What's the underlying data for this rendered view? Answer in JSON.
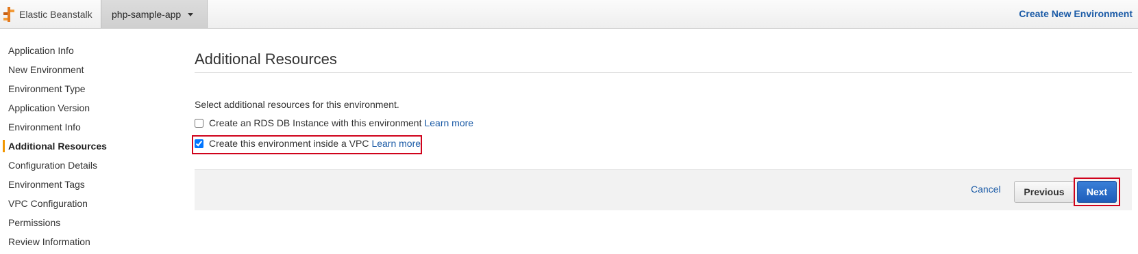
{
  "topbar": {
    "brand_label": "Elastic Beanstalk",
    "brand_icon": "beanstalk-logo-icon",
    "app_selector_label": "php-sample-app",
    "create_env_link": "Create New Environment"
  },
  "sidebar": {
    "items": [
      {
        "label": "Application Info"
      },
      {
        "label": "New Environment"
      },
      {
        "label": "Environment Type"
      },
      {
        "label": "Application Version"
      },
      {
        "label": "Environment Info"
      },
      {
        "label": "Additional Resources",
        "active": true
      },
      {
        "label": "Configuration Details"
      },
      {
        "label": "Environment Tags"
      },
      {
        "label": "VPC Configuration"
      },
      {
        "label": "Permissions"
      },
      {
        "label": "Review Information"
      }
    ]
  },
  "main": {
    "title": "Additional Resources",
    "intro": "Select additional resources for this environment.",
    "options": [
      {
        "label": "Create an RDS DB Instance with this environment",
        "link": "Learn more",
        "checked": false
      },
      {
        "label": "Create this environment inside a VPC",
        "link": "Learn more",
        "checked": true
      }
    ],
    "footer": {
      "cancel": "Cancel",
      "previous": "Previous",
      "next": "Next"
    }
  },
  "colors": {
    "accent": "#f19600",
    "link": "#1a5aa6",
    "primary_button": "#1e5db9",
    "highlight": "#d0021b"
  }
}
